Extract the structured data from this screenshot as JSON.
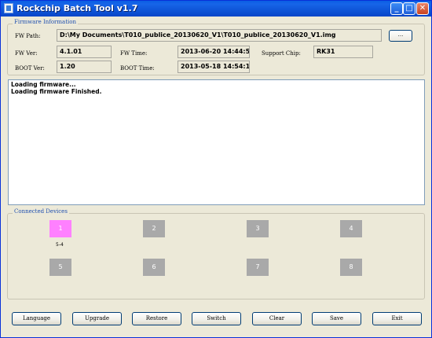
{
  "window": {
    "title": "Rockchip Batch Tool v1.7"
  },
  "firmware": {
    "group_label": "Firmware Information",
    "fw_path_label": "FW Path:",
    "fw_path_value": "D:\\My Documents\\T010_publice_20130620_V1\\T010_publice_20130620_V1.img",
    "browse_label": "...",
    "fw_ver_label": "FW Ver:",
    "fw_ver_value": "4.1.01",
    "fw_time_label": "FW Time:",
    "fw_time_value": "2013-06-20 14:44:58",
    "support_chip_label": "Support Chip:",
    "support_chip_value": "RK31",
    "boot_ver_label": "BOOT Ver:",
    "boot_ver_value": "1.20",
    "boot_time_label": "BOOT Time:",
    "boot_time_value": "2013-05-18 14:54:12"
  },
  "log": {
    "lines": [
      "Loading firmware...",
      "Loading firmware Finished."
    ]
  },
  "devices": {
    "group_label": "Connected Devices",
    "slots": [
      "1",
      "2",
      "3",
      "4",
      "5",
      "6",
      "7",
      "8"
    ],
    "active_slot": "1",
    "slot1_location": "5-4",
    "active_color": "#ff80ff",
    "inactive_color": "#a9a9a9"
  },
  "buttons": {
    "language": "Language",
    "upgrade": "Upgrade",
    "restore": "Restore",
    "switch": "Switch",
    "clear": "Clear",
    "save": "Save",
    "exit": "Exit"
  }
}
